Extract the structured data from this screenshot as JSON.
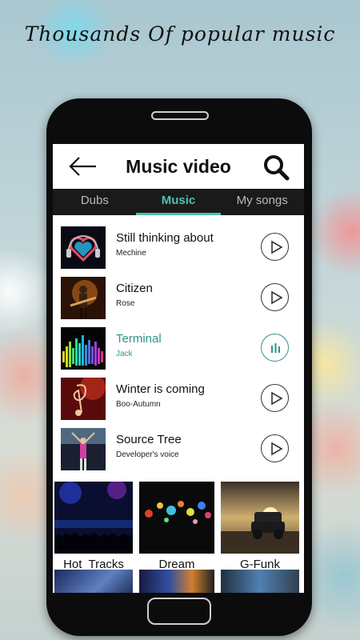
{
  "promo": {
    "headline": "Thousands Of popular music"
  },
  "app_bar": {
    "title": "Music video",
    "back_icon": "back-arrow-icon",
    "search_icon": "search-icon"
  },
  "tabs": [
    {
      "label": "Dubs",
      "active": false
    },
    {
      "label": "Music",
      "active": true
    },
    {
      "label": "My songs",
      "active": false
    }
  ],
  "songs": [
    {
      "title": "Still thinking about",
      "artist": "Mechine",
      "state": "play"
    },
    {
      "title": "Citizen",
      "artist": "Rose",
      "state": "play"
    },
    {
      "title": "Terminal",
      "artist": "Jack",
      "state": "playing"
    },
    {
      "title": "Winter is coming",
      "artist": "Boo-Autumn",
      "state": "play"
    },
    {
      "title": "Source Tree",
      "artist": "Developer's voice",
      "state": "play"
    }
  ],
  "categories": [
    {
      "label": "Hot  Tracks"
    },
    {
      "label": "Dream"
    },
    {
      "label": "G-Funk"
    }
  ],
  "colors": {
    "accent": "#4fc0b1",
    "active_text": "#2f9488",
    "tab_bar": "#1a1a1a"
  }
}
